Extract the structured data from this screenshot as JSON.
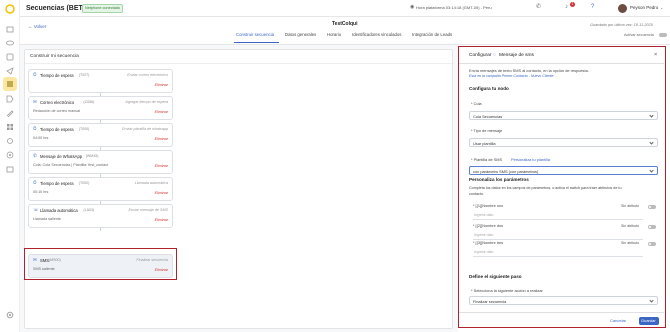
{
  "topbar": {
    "title": "Secuencias (BETA)",
    "badge": "Netphone conectado",
    "clock": "Hora plataforma 03:14:18 (GMT-05) - Perú",
    "notif_count": "1",
    "user_name": "Peyson Pedro"
  },
  "subbar": {
    "back": "← Volver",
    "sequence_name": "TestColqui",
    "saved": "Guardado por última vez: 18-11-2025",
    "activate": "Activar secuencia",
    "tabs": [
      "Construir secuencia",
      "Datos generales",
      "Horario",
      "Identificadores vinculados",
      "Integración de Leads"
    ]
  },
  "builder": {
    "title": "Construir mi secuencia",
    "cards": [
      {
        "title": "Tiempo de espera",
        "id": "(T027)",
        "sub": "",
        "action": "Enviar correo electrónico",
        "remove": "Eliminar"
      },
      {
        "title": "Correo electrónico",
        "id": "(C056)",
        "sub": "Redacción de correo manual",
        "action": "Agregar tiempo de espera",
        "remove": "Eliminar"
      },
      {
        "title": "Tiempo de espera",
        "id": "(T000)",
        "sub": "04:00 hrs",
        "action": "Enviar plantilla de whatsapp",
        "remove": "Eliminar"
      },
      {
        "title": "Mensaje de WhatsApp",
        "id": "(WM45)",
        "sub": "Cola: Cola Secuencias | Plantilla: first_contact",
        "action": "",
        "remove": "Eliminar"
      },
      {
        "title": "Tiempo de espera",
        "id": "(T002)",
        "sub": "00:10 hrs",
        "action": "Llamada automática",
        "remove": "Eliminar"
      },
      {
        "title": "Llamada automática",
        "id": "(LA03)",
        "sub": "Llamada saliente",
        "action": "Enviar mensaje de SMS",
        "remove": "Eliminar"
      },
      {
        "title": "SMS",
        "id": "(MS00)",
        "sub": "SMS saliente",
        "action": "Finalizar secuencia",
        "remove": "Eliminar"
      }
    ]
  },
  "panel": {
    "title_prefix": "Configurar",
    "title_suffix": "Mensaje de sms",
    "desc": "Envía mensajes de texto SMS al contacto, en la opción de respuesta.",
    "link": "Está en la campaña Primer Contacto - Nuevo Cliente",
    "section_node": "Configura tu nodo",
    "cola_label": "* Cola",
    "cola_value": "Cola Secuencias",
    "tipo_label": "* Tipo de mensaje",
    "tipo_value": "Usar plantilla",
    "plantilla_label": "* Plantilla de SMS",
    "plantilla_link": "Personaliza tu plantilla",
    "plantilla_value": "con parámetro SMS (con parámetros)",
    "params_title": "Personaliza los parámetros",
    "params_desc1": "Completa los datos en los campos de parámetros, o activa el switch para traer atributos de tu",
    "params_desc2": "contacto.",
    "params": [
      {
        "label": "* [{1}]Nombre uno",
        "toggle": "Sin atributo",
        "placeholder": "Ingrese dato"
      },
      {
        "label": "* [{2}]Nombre dos",
        "toggle": "Sin atributo",
        "placeholder": "Ingrese dato"
      },
      {
        "label": "* [{3}]Nombre tres",
        "toggle": "Sin atributo",
        "placeholder": "Ingrese dato"
      }
    ],
    "next_title": "Define el siguiente paso",
    "next_label": "* Selecciona la siguiente acción a realizar",
    "next_value": "Finalizar secuencia",
    "cancel": "Cancelar",
    "save": "Guardar"
  }
}
